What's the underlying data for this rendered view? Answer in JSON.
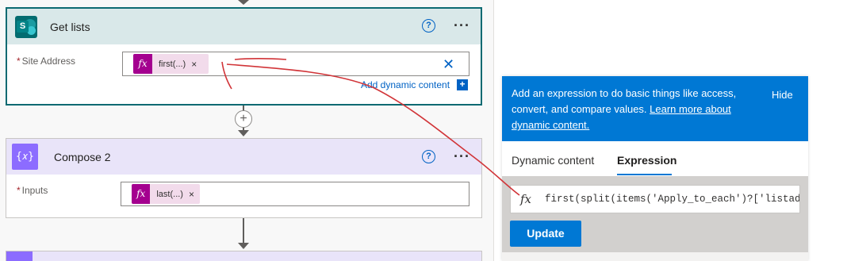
{
  "cards": {
    "get_lists": {
      "title": "Get lists",
      "field_label": "Site Address",
      "required_mark": "*",
      "token_label": "first(...)",
      "token_remove": "×",
      "clear": "✕",
      "add_dynamic": "Add dynamic content",
      "add_plus": "+",
      "help": "?",
      "more": "···"
    },
    "compose": {
      "title": "Compose 2",
      "field_label": "Inputs",
      "required_mark": "*",
      "token_label": "last(...)",
      "token_remove": "×",
      "icon_text": "{𝑥}",
      "help": "?",
      "more": "···"
    }
  },
  "add_step": "+",
  "panel": {
    "tip_prefix": "Add an expression to do basic things like access, convert, and compare values. ",
    "tip_link": "Learn more about dynamic content.",
    "hide": "Hide",
    "tabs": [
      "Dynamic content",
      "Expression"
    ],
    "active_tab": "Expression",
    "expression": "first(split(items('Apply_to_each')?['listaddress']",
    "update": "Update"
  },
  "icons": {
    "sharepoint": "sharepoint-icon",
    "compose": "compose-icon",
    "fx": "fx-icon"
  },
  "colors": {
    "teal_header": "#d9e8e9",
    "teal_border": "#0b6a72",
    "purple_header": "#e9e4f9",
    "token_bg": "#f2dbeb",
    "fx_magenta": "#a4008f",
    "link_blue": "#0062c4",
    "panel_blue": "#0078d4",
    "annotation_red": "#d13438"
  }
}
